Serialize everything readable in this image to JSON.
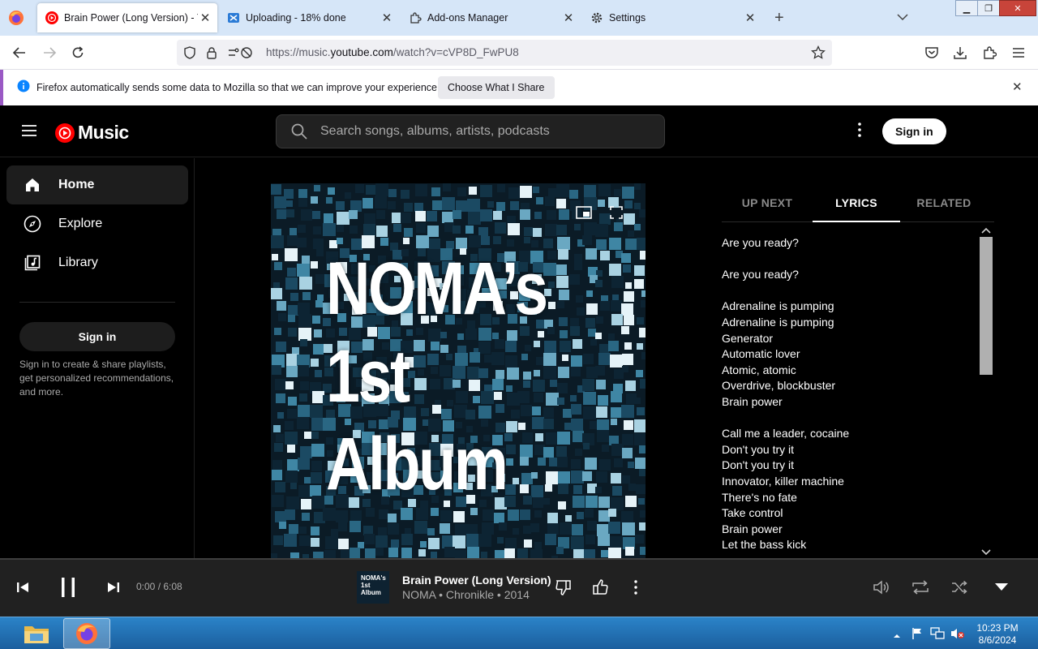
{
  "browser": {
    "tabs": [
      {
        "title": "Brain Power (Long Version) - YouTube Music",
        "active": true
      },
      {
        "title": "Uploading - 18% done",
        "active": false
      },
      {
        "title": "Add-ons Manager",
        "active": false
      },
      {
        "title": "Settings",
        "active": false
      }
    ],
    "url_prefix": "https://music.",
    "url_domain": "youtube.com",
    "url_suffix": "/watch?v=cVP8D_FwPU8"
  },
  "notification": {
    "text": "Firefox automatically sends some data to Mozilla so that we can improve your experience.",
    "button_label": "Choose What I Share"
  },
  "ytmusic": {
    "logo_text": "Music",
    "search_placeholder": "Search songs, albums, artists, podcasts",
    "signin_label": "Sign in",
    "nav": [
      {
        "label": "Home",
        "icon": "home-icon",
        "active": true
      },
      {
        "label": "Explore",
        "icon": "compass-icon",
        "active": false
      },
      {
        "label": "Library",
        "icon": "library-icon",
        "active": false
      }
    ],
    "sidebar_signin_label": "Sign in",
    "sidebar_desc": "Sign in to create & share playlists, get personalized recommendations, and more.",
    "album_art_lines": [
      "NOMA’s",
      "1st",
      "Album"
    ],
    "panel_tabs": [
      {
        "label": "UP NEXT",
        "active": false
      },
      {
        "label": "LYRICS",
        "active": true
      },
      {
        "label": "RELATED",
        "active": false
      }
    ],
    "lyrics": [
      "Are you ready?",
      "",
      "Are you ready?",
      "",
      "Adrenaline is pumping",
      "Adrenaline is pumping",
      "Generator",
      "Automatic lover",
      "Atomic, atomic",
      "Overdrive, blockbuster",
      "Brain power",
      "",
      "Call me a leader, cocaine",
      "Don't you try it",
      "Don't you try it",
      "Innovator, killer machine",
      "There's no fate",
      "Take control",
      "Brain power",
      "Let the bass kick"
    ]
  },
  "player": {
    "time": "0:00 / 6:08",
    "progress": 0,
    "song_title": "Brain Power (Long Version)",
    "song_subtitle": "NOMA • Chronikle • 2014",
    "thumb_lines": [
      "NOMA's",
      "1st",
      "Album"
    ]
  },
  "taskbar": {
    "time": "10:23 PM",
    "date": "8/6/2024"
  }
}
